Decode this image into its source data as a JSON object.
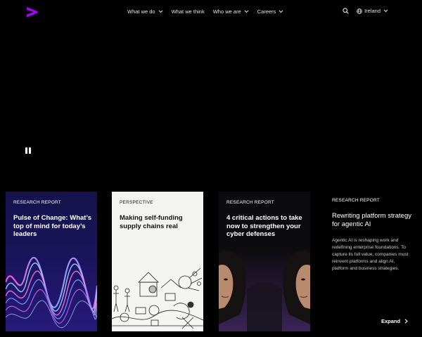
{
  "nav": {
    "logo_icon": "greater-than-logo-icon",
    "brand_color": "#a100ff",
    "menu": [
      "What we do",
      "What we think",
      "Who we are",
      "Careers"
    ],
    "menu_has_dropdown": [
      true,
      false,
      true,
      true
    ],
    "search_icon": "search-icon",
    "region_icon": "globe-icon",
    "region": "Ireland"
  },
  "hero": {
    "pause_icon": "pause-icon"
  },
  "cards": [
    {
      "tag": "RESEARCH REPORT",
      "title": "Pulse of Change: What’s top of mind for today’s leaders",
      "art": "neon-waves-image"
    },
    {
      "tag": "PERSPECTIVE",
      "title": "Making self-funding supply chains real",
      "art": "line-drawing-illustration"
    },
    {
      "tag": "RESEARCH REPORT",
      "title": "4 critical actions to take now to strengthen your cyber defenses",
      "art": "mirrored-faces-image"
    }
  ],
  "feature": {
    "tag": "RESEARCH REPORT",
    "title": "Rewriting platform strategy for agentic AI",
    "description": "Agentic AI is reshaping work and redefining enterprise foundations. To capture its full value, companies must reinvent platforms and align AI, platform and business strategies.",
    "expand_label": "Expand",
    "expand_icon": "chevron-right-icon"
  }
}
